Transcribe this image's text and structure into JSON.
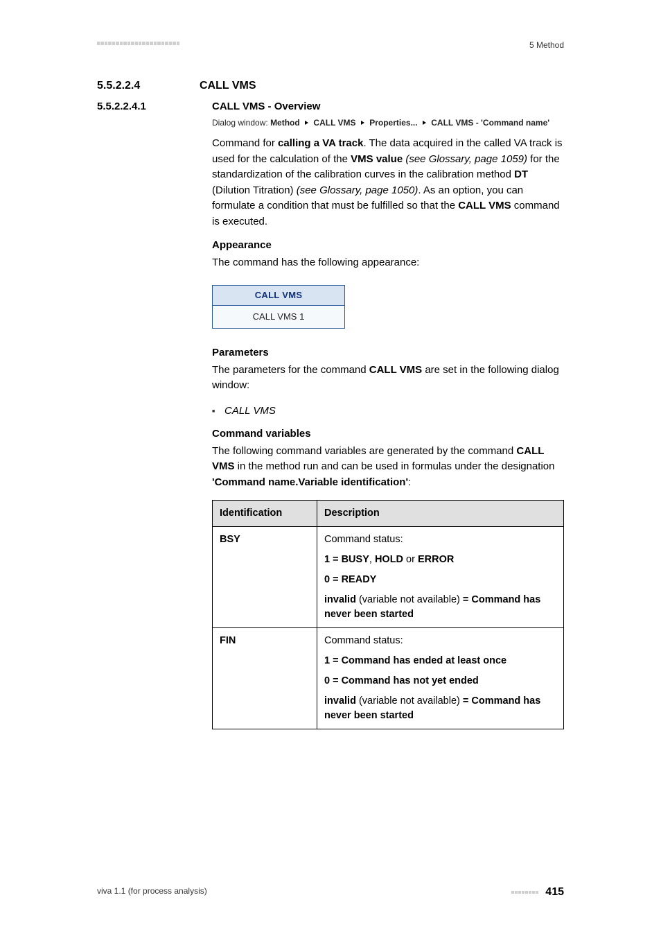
{
  "header": {
    "chapter": "5 Method"
  },
  "section": {
    "num": "5.5.2.2.4",
    "title": "CALL VMS"
  },
  "subsection": {
    "num": "5.5.2.2.4.1",
    "title": "CALL VMS - Overview"
  },
  "dialog": {
    "prefix": "Dialog window:",
    "p0": "Method",
    "p1": "CALL VMS",
    "p2": "Properties...",
    "p3": "CALL VMS - 'Command name'"
  },
  "intro": {
    "t0": "Command for ",
    "b0": "calling a VA track",
    "t1": ". The data acquired in the called VA track is used for the calculation of the ",
    "b1": "VMS value",
    "t2": " ",
    "i0": "(see Glossary, page 1059)",
    "t3": " for the standardization of the calibration curves in the calibration method ",
    "b2": "DT",
    "t4": " (Dilution Titration) ",
    "i1": "(see Glossary, page 1050)",
    "t5": ". As an option, you can formulate a condition that must be fulfilled so that the ",
    "b3": "CALL VMS",
    "t6": " command is executed."
  },
  "appearance": {
    "heading": "Appearance",
    "text": "The command has the following appearance:",
    "box_head": "CALL VMS",
    "box_body": "CALL VMS 1"
  },
  "parameters": {
    "heading": "Parameters",
    "t0": "The parameters for the command ",
    "b0": "CALL VMS",
    "t1": " are set in the following dialog window:",
    "item0": "CALL VMS"
  },
  "cmdvars": {
    "heading": "Command variables",
    "t0": "The following command variables are generated by the command ",
    "b0": "CALL VMS",
    "t1": " in the method run and can be used in formulas under the designation ",
    "b1": "'Command name.Variable identification'",
    "t2": ":"
  },
  "table": {
    "col0": "Identification",
    "col1": "Description",
    "rows": [
      {
        "id": "BSY",
        "lines": {
          "l0_plain": "Command status:",
          "l1_b0": "1 = BUSY",
          "l1_t0": ", ",
          "l1_b1": "HOLD",
          "l1_t1": " or ",
          "l1_b2": "ERROR",
          "l2_b0": "0 = READY",
          "l3_b0": "invalid",
          "l3_t0": " (variable not available) ",
          "l3_b1": "= Command has never been started"
        }
      },
      {
        "id": "FIN",
        "lines": {
          "l0_plain": "Command status:",
          "l1_b0": "1 = Command has ended at least once",
          "l2_b0": "0 = Command has not yet ended",
          "l3_b0": "invalid",
          "l3_t0": " (variable not available) ",
          "l3_b1": "= Command has never been started"
        }
      }
    ]
  },
  "footer": {
    "left": "viva 1.1 (for process analysis)",
    "page": "415"
  }
}
